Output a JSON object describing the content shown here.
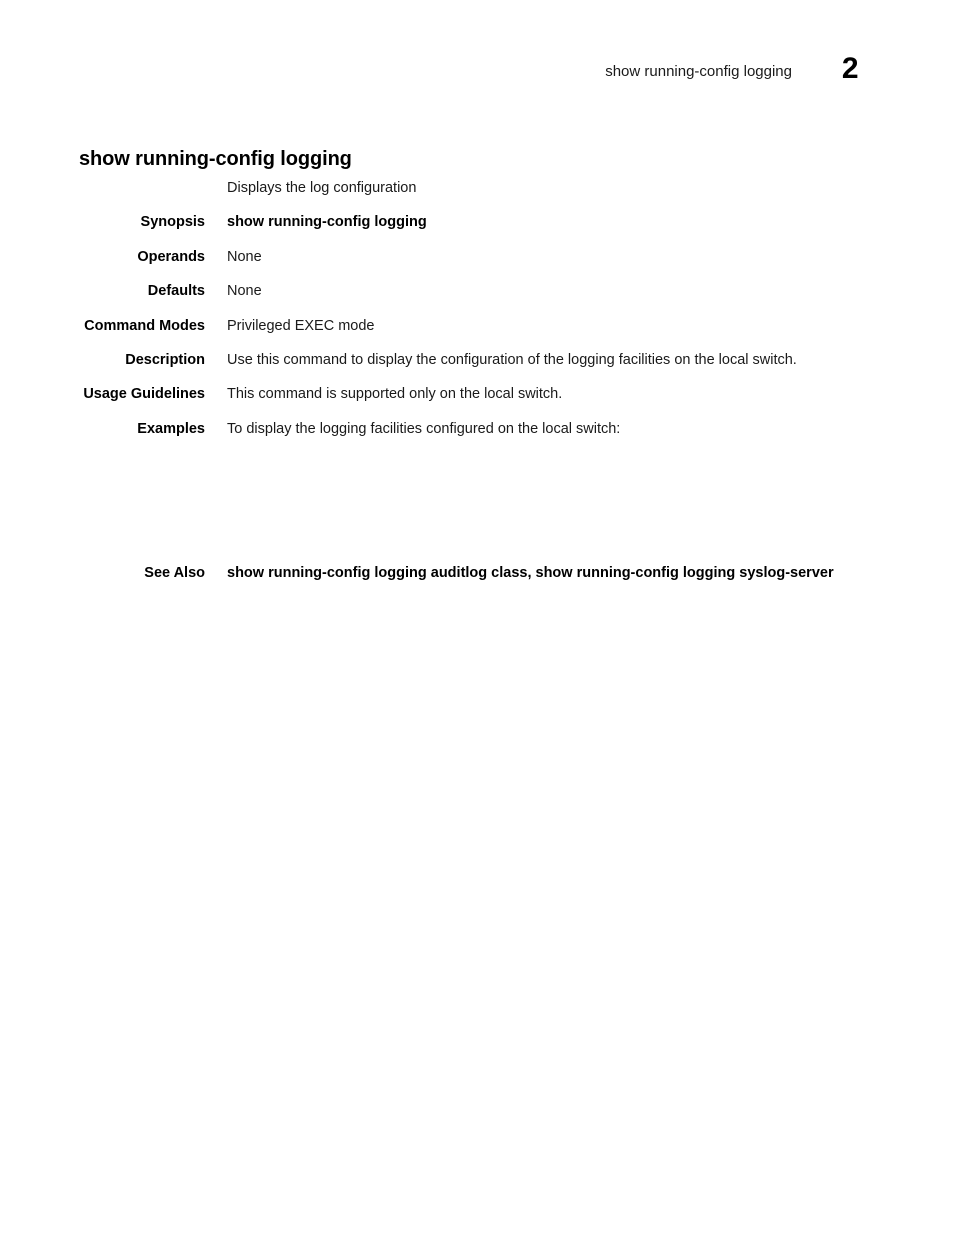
{
  "document": {
    "header": {
      "running_title": "show running-config logging",
      "page_number": "2"
    },
    "command_title": "show running-config logging",
    "definition_rows": [
      {
        "label": "",
        "value": "Displays the log configuration",
        "bold": false
      },
      {
        "label": "Synopsis",
        "value": "show running-config logging",
        "bold": true
      },
      {
        "label": "Operands",
        "value": "None",
        "bold": false
      },
      {
        "label": "Defaults",
        "value": "None",
        "bold": false
      },
      {
        "label": "Command Modes",
        "value": "Privileged EXEC mode",
        "bold": false
      },
      {
        "label": "Description",
        "value": "Use this command to display the configuration of the logging facilities on the local switch.",
        "bold": false
      },
      {
        "label": "Usage Guidelines",
        "value": "This command is supported only on the local switch.",
        "bold": false
      },
      {
        "label": "Examples",
        "value": "To display the logging facilities configured on the local switch:",
        "bold": false
      }
    ],
    "example_output": "",
    "see_also": {
      "label": "See Also",
      "value": "show running-config logging auditlog class, show running-config logging syslog-server"
    },
    "colors": {
      "page_background": "#ffffff",
      "body_text": "#1a1a1a",
      "heading_text": "#000000"
    }
  }
}
